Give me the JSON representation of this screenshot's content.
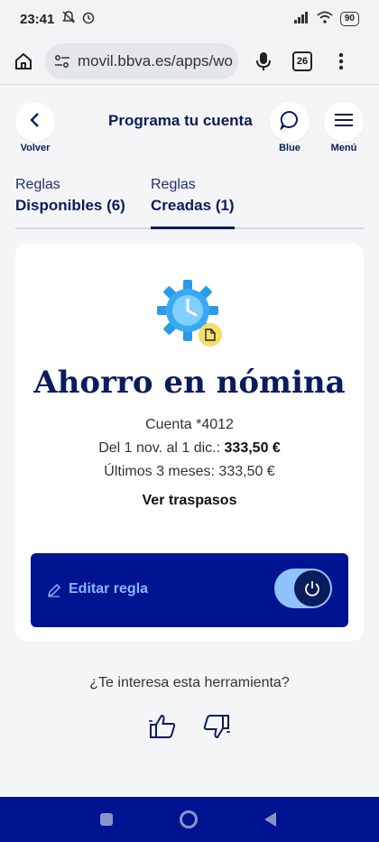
{
  "status": {
    "time": "23:41",
    "battery": "90"
  },
  "browser": {
    "url": "movil.bbva.es/apps/wo",
    "tabs": "26"
  },
  "header": {
    "title": "Programa tu cuenta",
    "back": "Volver",
    "blue": "Blue",
    "menu": "Menú"
  },
  "tabs": [
    {
      "line1": "Reglas",
      "line2": "Disponibles (6)"
    },
    {
      "line1": "Reglas",
      "line2": "Creadas (1)"
    }
  ],
  "card": {
    "title": "Ahorro en nómina",
    "account": "Cuenta *4012",
    "period_label": "Del 1 nov. al 1 dic.:",
    "period_amount": "333,50 €",
    "last3": "Últimos 3 meses: 333,50 €",
    "transfers": "Ver traspasos",
    "edit": "Editar regla"
  },
  "feedback": {
    "question": "¿Te interesa esta herramienta?"
  },
  "colors": {
    "brand": "#0a1c5c",
    "dark_blue": "#001391",
    "light_blue": "#8fc3ff"
  }
}
